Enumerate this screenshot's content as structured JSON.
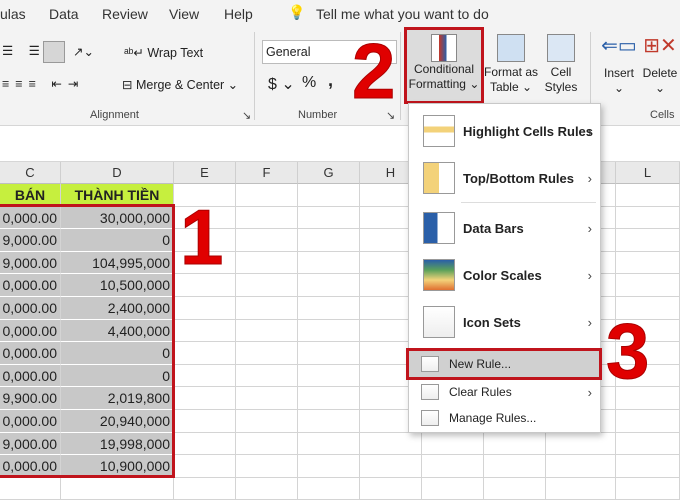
{
  "tabs": [
    "ulas",
    "Data",
    "Review",
    "View",
    "Help"
  ],
  "tell_me": "Tell me what you want to do",
  "alignment": {
    "wrap_text": "Wrap Text",
    "merge_center": "Merge & Center",
    "group": "Alignment"
  },
  "number": {
    "format": "General",
    "currency": "$",
    "percent": "%",
    "comma": ",",
    "group": "Number"
  },
  "styles": {
    "conditional_formatting": [
      "Conditional",
      "Formatting"
    ],
    "format_as_table": [
      "Format as",
      "Table"
    ],
    "cell_styles": [
      "Cell",
      "Styles"
    ]
  },
  "cells": {
    "insert": "Insert",
    "delete": "Delete",
    "group": "Cells"
  },
  "columns": [
    "C",
    "D",
    "E",
    "F",
    "G",
    "H",
    "L"
  ],
  "header_row": {
    "c": "BÁN",
    "d": "THÀNH TIỀN"
  },
  "rows": [
    {
      "c": "0,000.00",
      "d": "30,000,000"
    },
    {
      "c": "9,000.00",
      "d": "0"
    },
    {
      "c": "9,000.00",
      "d": "104,995,000"
    },
    {
      "c": "0,000.00",
      "d": "10,500,000"
    },
    {
      "c": "0,000.00",
      "d": "2,400,000"
    },
    {
      "c": "0,000.00",
      "d": "4,400,000"
    },
    {
      "c": "0,000.00",
      "d": "0"
    },
    {
      "c": "0,000.00",
      "d": "0"
    },
    {
      "c": "9,900.00",
      "d": "2,019,800"
    },
    {
      "c": "0,000.00",
      "d": "20,940,000"
    },
    {
      "c": "9,000.00",
      "d": "19,998,000"
    },
    {
      "c": "0,000.00",
      "d": "10,900,000"
    }
  ],
  "menu": {
    "items": [
      "Highlight Cells Rules",
      "Top/Bottom Rules",
      "Data Bars",
      "Color Scales",
      "Icon Sets",
      "New Rule...",
      "Clear Rules",
      "Manage Rules..."
    ]
  },
  "steps": [
    "1",
    "2",
    "3"
  ],
  "colors": {
    "header_fill": "#c6ef3e",
    "annotation": "#e00000",
    "selection": "#c8c8c8"
  }
}
